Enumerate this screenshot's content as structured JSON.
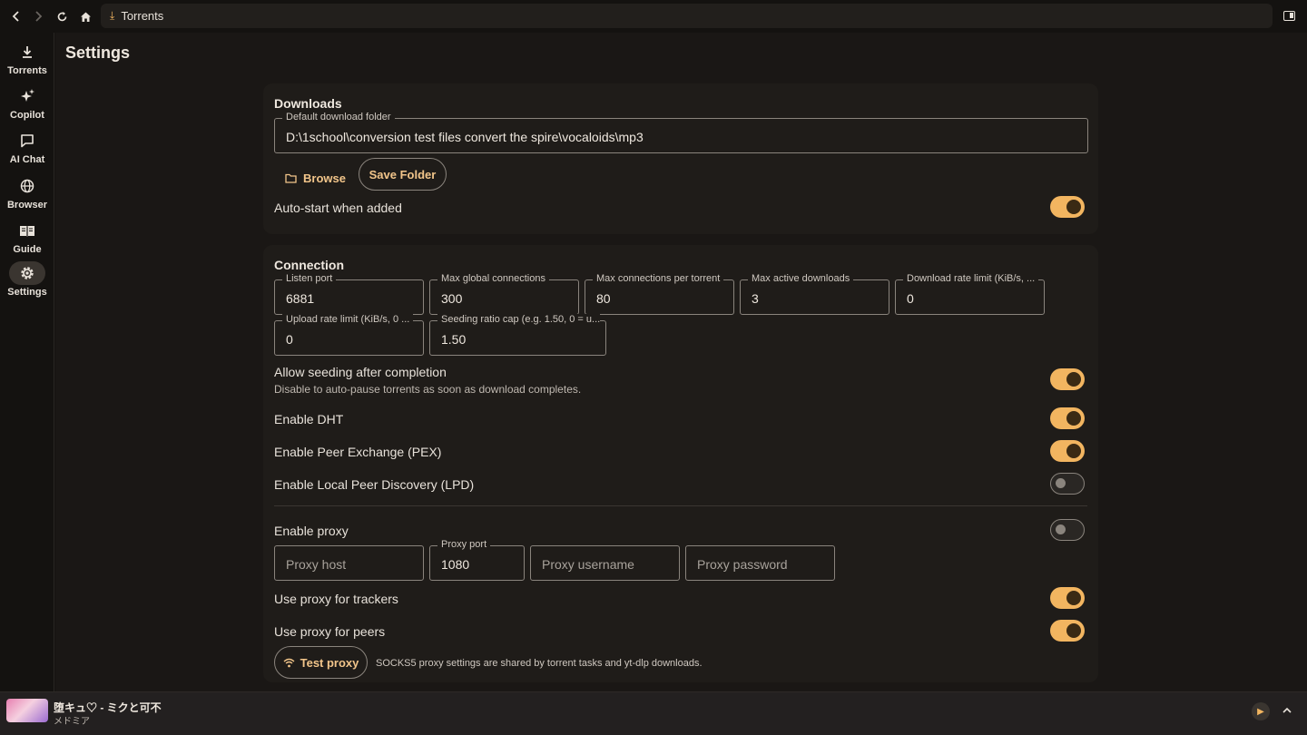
{
  "addressbar": {
    "title": "Torrents"
  },
  "sidebar": {
    "items": [
      {
        "label": "Torrents",
        "icon": "download-icon"
      },
      {
        "label": "Copilot",
        "icon": "sparkle-icon"
      },
      {
        "label": "AI Chat",
        "icon": "chat-icon"
      },
      {
        "label": "Browser",
        "icon": "globe-icon"
      },
      {
        "label": "Guide",
        "icon": "book-icon"
      },
      {
        "label": "Settings",
        "icon": "gear-icon",
        "active": true
      }
    ]
  },
  "page": {
    "title": "Settings"
  },
  "downloads": {
    "heading": "Downloads",
    "folder_label": "Default download folder",
    "folder_value": "D:\\1school\\conversion test files convert the spire\\vocaloids\\mp3",
    "browse_label": "Browse",
    "save_label": "Save Folder",
    "autostart_label": "Auto-start when added",
    "autostart_on": true
  },
  "connection": {
    "heading": "Connection",
    "listen_port": {
      "label": "Listen port",
      "value": "6881"
    },
    "max_global": {
      "label": "Max global connections",
      "value": "300"
    },
    "max_per_torrent": {
      "label": "Max connections per torrent",
      "value": "80"
    },
    "max_active": {
      "label": "Max active downloads",
      "value": "3"
    },
    "download_limit": {
      "label": "Download rate limit (KiB/s, ...",
      "value": "0"
    },
    "upload_limit": {
      "label": "Upload rate limit (KiB/s, 0 ...",
      "value": "0"
    },
    "seed_ratio": {
      "label": "Seeding ratio cap (e.g. 1.50, 0 = u...",
      "value": "1.50"
    },
    "allow_seeding": {
      "label": "Allow seeding after completion",
      "sub": "Disable to auto-pause torrents as soon as download completes.",
      "on": true
    },
    "dht": {
      "label": "Enable DHT",
      "on": true
    },
    "pex": {
      "label": "Enable Peer Exchange (PEX)",
      "on": true
    },
    "lpd": {
      "label": "Enable Local Peer Discovery (LPD)",
      "on": false
    },
    "proxy": {
      "label": "Enable proxy",
      "on": false
    },
    "proxy_host": {
      "placeholder": "Proxy host"
    },
    "proxy_port": {
      "label": "Proxy port",
      "value": "1080"
    },
    "proxy_user": {
      "placeholder": "Proxy username"
    },
    "proxy_pass": {
      "placeholder": "Proxy password"
    },
    "proxy_trackers": {
      "label": "Use proxy for trackers",
      "on": true
    },
    "proxy_peers": {
      "label": "Use proxy for peers",
      "on": true
    },
    "test_proxy_label": "Test proxy",
    "proxy_note": "SOCKS5 proxy settings are shared by torrent tasks and yt-dlp downloads."
  },
  "player": {
    "title": "堕キュ♡ - ミクと可不",
    "artist": "メドミア"
  },
  "colors": {
    "accent": "#f2b560",
    "background": "#1a1715",
    "card": "#1f1c19"
  }
}
